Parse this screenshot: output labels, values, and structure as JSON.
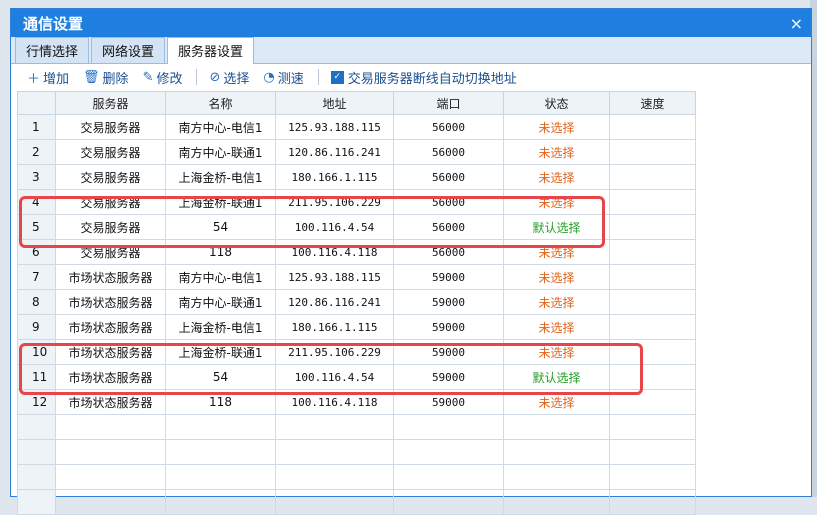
{
  "window": {
    "title": "通信设置",
    "close_glyph": "×"
  },
  "tabs": [
    {
      "label": "行情选择"
    },
    {
      "label": "网络设置"
    },
    {
      "label": "服务器设置",
      "active": true
    }
  ],
  "toolbar": {
    "add": "增加",
    "delete": "删除",
    "edit": "修改",
    "select": "选择",
    "speed_test": "测速",
    "auto_switch": "交易服务器断线自动切换地址"
  },
  "columns": [
    "",
    "服务器",
    "名称",
    "地址",
    "端口",
    "状态",
    "速度"
  ],
  "rows": [
    {
      "num": "1",
      "server": "交易服务器",
      "name": "南方中心-电信1",
      "address": "125.93.188.115",
      "port": "56000",
      "status": "未选择",
      "speed": ""
    },
    {
      "num": "2",
      "server": "交易服务器",
      "name": "南方中心-联通1",
      "address": "120.86.116.241",
      "port": "56000",
      "status": "未选择",
      "speed": ""
    },
    {
      "num": "3",
      "server": "交易服务器",
      "name": "上海金桥-电信1",
      "address": "180.166.1.115",
      "port": "56000",
      "status": "未选择",
      "speed": ""
    },
    {
      "num": "4",
      "server": "交易服务器",
      "name": "上海金桥-联通1",
      "address": "211.95.106.229",
      "port": "56000",
      "status": "未选择",
      "speed": ""
    },
    {
      "num": "5",
      "server": "交易服务器",
      "name": "54",
      "address": "100.116.4.54",
      "port": "56000",
      "status": "默认选择",
      "speed": ""
    },
    {
      "num": "6",
      "server": "交易服务器",
      "name": "118",
      "address": "100.116.4.118",
      "port": "56000",
      "status": "未选择",
      "speed": ""
    },
    {
      "num": "7",
      "server": "市场状态服务器",
      "name": "南方中心-电信1",
      "address": "125.93.188.115",
      "port": "59000",
      "status": "未选择",
      "speed": ""
    },
    {
      "num": "8",
      "server": "市场状态服务器",
      "name": "南方中心-联通1",
      "address": "120.86.116.241",
      "port": "59000",
      "status": "未选择",
      "speed": ""
    },
    {
      "num": "9",
      "server": "市场状态服务器",
      "name": "上海金桥-电信1",
      "address": "180.166.1.115",
      "port": "59000",
      "status": "未选择",
      "speed": ""
    },
    {
      "num": "10",
      "server": "市场状态服务器",
      "name": "上海金桥-联通1",
      "address": "211.95.106.229",
      "port": "59000",
      "status": "未选择",
      "speed": ""
    },
    {
      "num": "11",
      "server": "市场状态服务器",
      "name": "54",
      "address": "100.116.4.54",
      "port": "59000",
      "status": "默认选择",
      "speed": ""
    },
    {
      "num": "12",
      "server": "市场状态服务器",
      "name": "118",
      "address": "100.116.4.118",
      "port": "59000",
      "status": "未选择",
      "speed": ""
    }
  ],
  "colors": {
    "accent": "#1e7fe0",
    "status_unselected": "#e0641b",
    "status_default": "#22a024",
    "highlight": "#e8454a"
  }
}
